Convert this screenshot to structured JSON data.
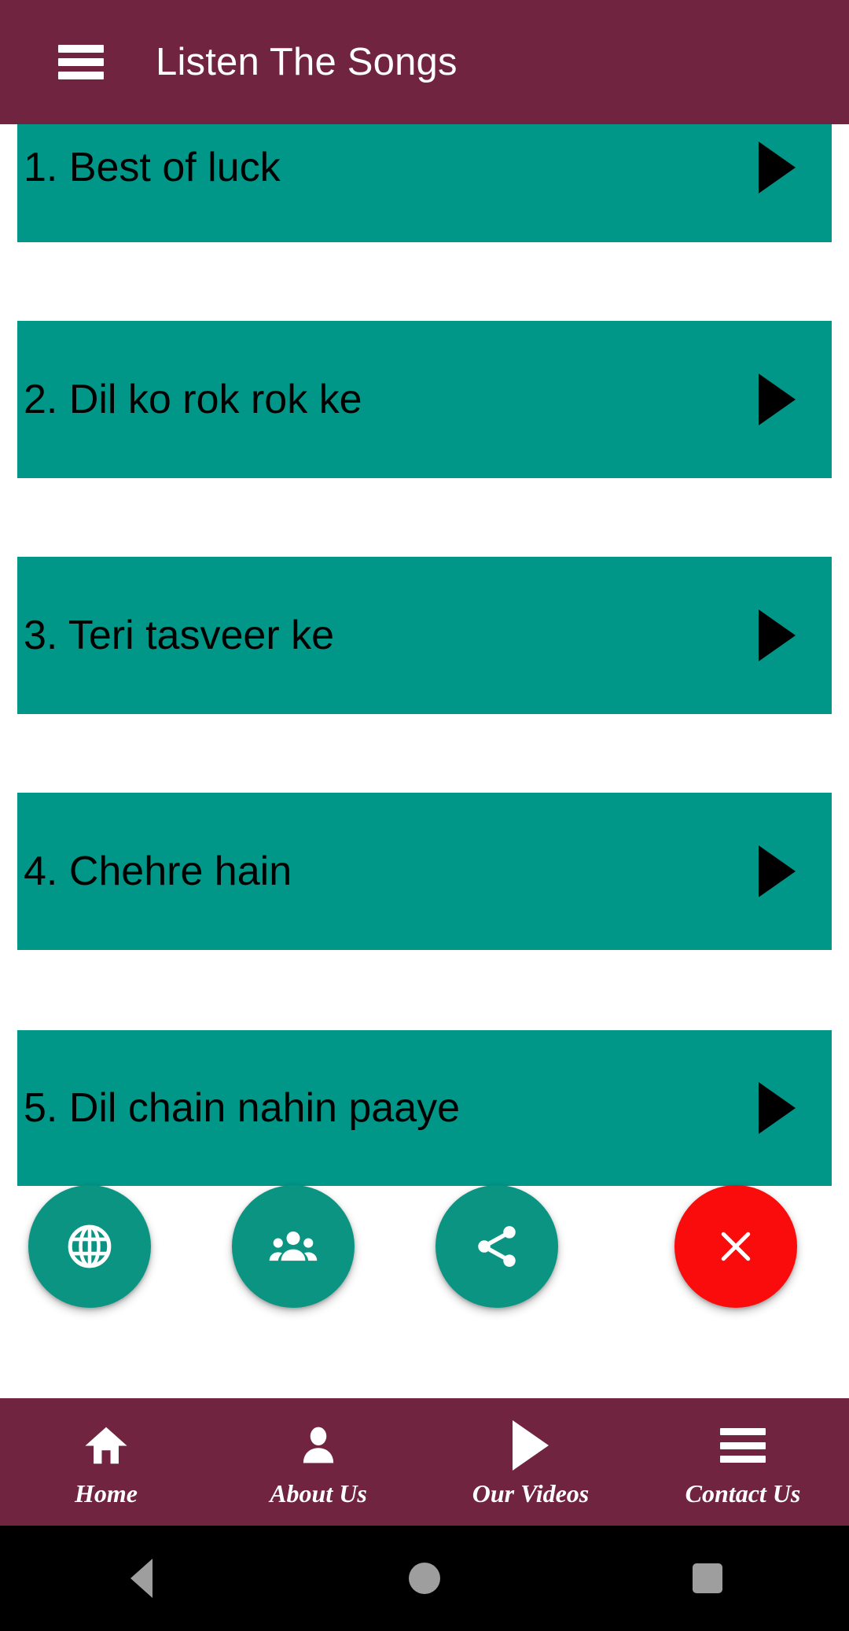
{
  "appbar": {
    "title": "Listen The Songs",
    "menu_icon": "hamburger-menu-icon",
    "background": "#70243F",
    "text_color": "#FFFFFF"
  },
  "song_list": {
    "card_color": "#009688",
    "text_color": "#000000",
    "play_icon": "play-triangle-icon",
    "items": [
      {
        "index": "1",
        "title": "1. Best of luck"
      },
      {
        "index": "2",
        "title": "2. Dil ko rok rok ke"
      },
      {
        "index": "3",
        "title": "3. Teri tasveer ke"
      },
      {
        "index": "4",
        "title": "4. Chehre hain"
      },
      {
        "index": "5",
        "title": "5. Dil chain nahin paaye"
      }
    ]
  },
  "fabs": {
    "accent_color": "#0C9482",
    "danger_color": "#FA0C0C",
    "items": [
      {
        "name": "website-fab",
        "icon": "globe-icon",
        "kind": "accent"
      },
      {
        "name": "community-fab",
        "icon": "people-group-icon",
        "kind": "accent"
      },
      {
        "name": "share-fab",
        "icon": "share-icon",
        "kind": "accent"
      },
      {
        "name": "close-fab",
        "icon": "close-x-icon",
        "kind": "danger"
      }
    ]
  },
  "bottom_nav": {
    "background": "#70243F",
    "text_color": "#FFFFFF",
    "items": [
      {
        "label": "Home",
        "icon": "home-icon"
      },
      {
        "label": "About Us",
        "icon": "person-icon"
      },
      {
        "label": "Our Videos",
        "icon": "play-triangle-icon"
      },
      {
        "label": "Contact Us",
        "icon": "hamburger-menu-icon"
      }
    ]
  },
  "system_nav": {
    "background": "#000000",
    "items": [
      {
        "name": "back-button",
        "icon": "back-triangle-icon"
      },
      {
        "name": "home-button",
        "icon": "home-circle-icon"
      },
      {
        "name": "recents-button",
        "icon": "recents-square-icon"
      }
    ]
  }
}
